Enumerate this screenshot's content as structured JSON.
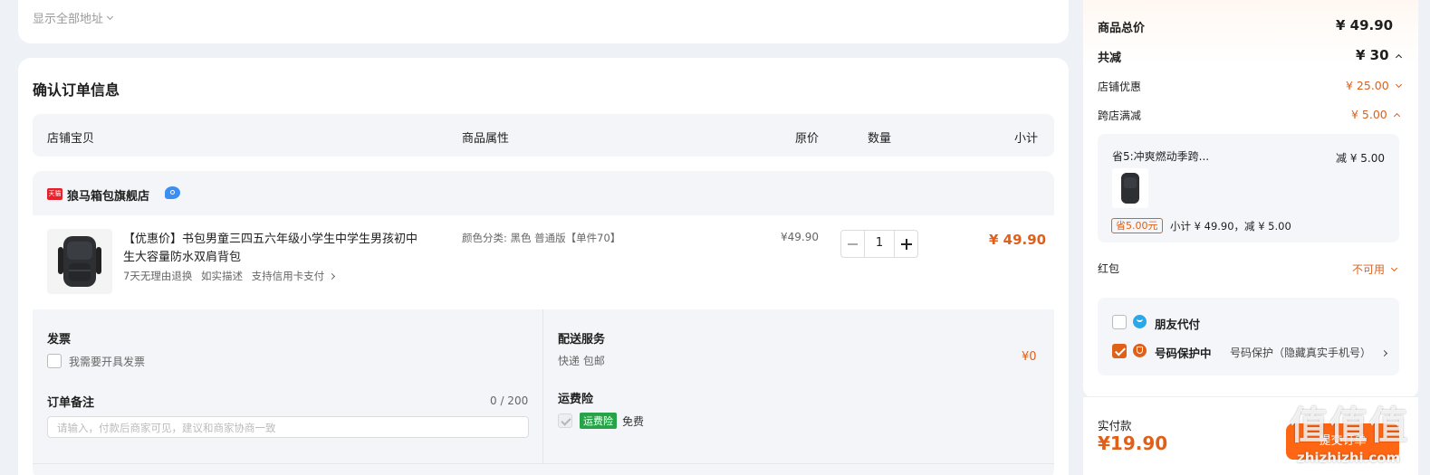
{
  "address": {
    "show_all_label": "显示全部地址"
  },
  "order": {
    "title": "确认订单信息",
    "columns": {
      "shop_item": "店铺宝贝",
      "attributes": "商品属性",
      "original_price": "原价",
      "quantity": "数量",
      "subtotal": "小计"
    },
    "shop": {
      "badge": "天猫",
      "name": "狼马箱包旗舰店"
    },
    "item": {
      "title_line1": "【优惠价】书包男童三四五六年级小学生中学生男孩初中",
      "title_line2": "生大容量防水双肩背包",
      "tags": [
        "7天无理由退换",
        "如实描述",
        "支持信用卡支付"
      ],
      "attribute": "颜色分类: 黑色 普通版【单件70】",
      "price": "¥49.90",
      "quantity": "1",
      "subtotal": "¥ 49.90"
    },
    "invoice": {
      "title": "发票",
      "checkbox_label": "我需要开具发票"
    },
    "remark": {
      "title": "订单备注",
      "counter": "0 / 200",
      "placeholder": "请输入，付款后商家可见，建议和商家协商一致"
    },
    "delivery": {
      "title": "配送服务",
      "value": "快递 包邮",
      "price": "¥0"
    },
    "shipping_insurance": {
      "title": "运费险",
      "badge": "运费险",
      "value": "免费"
    }
  },
  "summary": {
    "total_label": "商品总价",
    "total_value": "¥ 49.90",
    "reduce_label": "共减",
    "reduce_value": "¥ 30",
    "shop_discount_label": "店铺优惠",
    "shop_discount_value": "¥ 25.00",
    "cross_label": "跨店满减",
    "cross_value": "¥ 5.00",
    "promo": {
      "title": "省5:冲爽燃动季跨...",
      "reduce": "减 ¥ 5.00",
      "tag": "省5.00元",
      "detail": "小计 ¥ 49.90，减 ¥ 5.00"
    },
    "redpacket_label": "红包",
    "redpacket_value": "不可用",
    "friend_pay_label": "朋友代付",
    "privacy_label": "号码保护中",
    "privacy_detail": "号码保护（隐藏真实手机号）",
    "pay_label": "实付款",
    "pay_value": "¥19.90",
    "submit_label": "提交订单"
  },
  "watermark": {
    "text": "值值值",
    "url": "zhizhizhi.com"
  }
}
